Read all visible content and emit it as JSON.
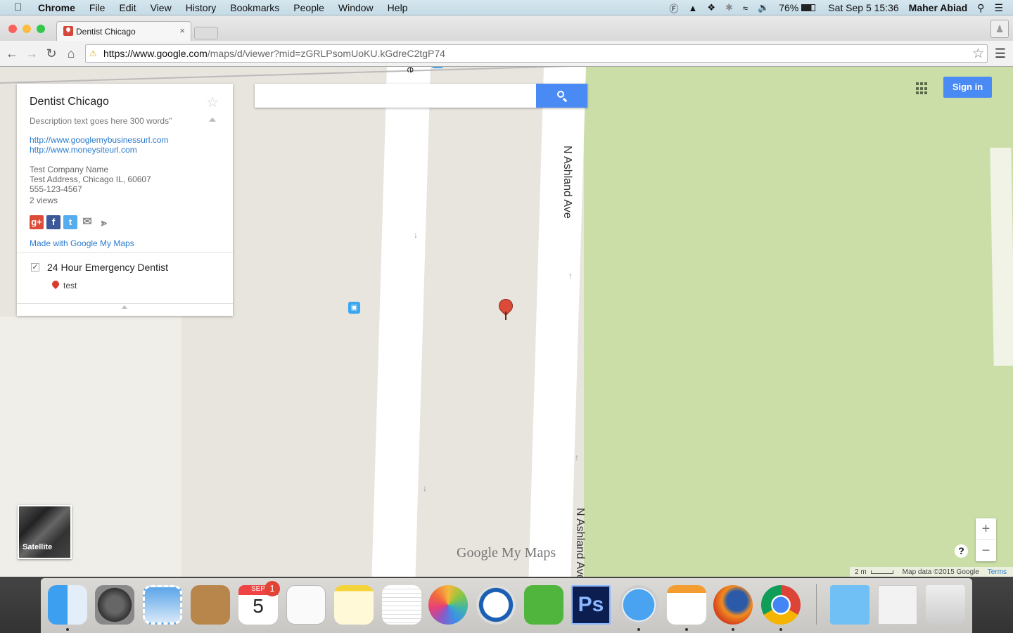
{
  "menubar": {
    "app_name": "Chrome",
    "items": [
      "File",
      "Edit",
      "View",
      "History",
      "Bookmarks",
      "People",
      "Window",
      "Help"
    ],
    "status": {
      "icons": [
        "typeeto-icon",
        "adobe-icon",
        "dropbox-icon",
        "bluetooth-icon",
        "wifi-icon",
        "volume-icon"
      ],
      "battery": "76%",
      "datetime": "Sat Sep 5  15:36",
      "user": "Maher Abiad"
    }
  },
  "browser": {
    "tab_title": "Dentist Chicago",
    "tab_close": "×",
    "url_host": "https://www.google.com",
    "url_path": "/maps/d/viewer?mid=zGRLPsomUoKU.kGdreC2tgP74"
  },
  "map_panel": {
    "title": "Dentist Chicago",
    "description": "Description text goes here 300 words\"",
    "links": [
      "http://www.googlemybusinessurl.com",
      "http://www.moneysiteurl.com"
    ],
    "company": "Test Company Name",
    "address": "Test Address, Chicago IL, 60607",
    "phone": "555-123-4567",
    "views": "2 views",
    "social": [
      {
        "name": "google-plus",
        "label": "g+",
        "color": "#dd4b39"
      },
      {
        "name": "facebook",
        "label": "f",
        "color": "#3b5998"
      },
      {
        "name": "twitter",
        "label": "t",
        "color": "#55acee"
      }
    ],
    "made_with": "Made with Google My Maps",
    "layer": {
      "name": "24 Hour Emergency Dentist",
      "checked": true,
      "features": [
        {
          "name": "test"
        }
      ]
    }
  },
  "search": {
    "value": "",
    "placeholder": ""
  },
  "map": {
    "street_labels": [
      "N Ashland Ave",
      "N Ashland Ave",
      "N Ashland Ave"
    ],
    "sign_in": "Sign in",
    "satellite_label": "Satellite",
    "watermark": "Google My Maps",
    "zoom_in": "+",
    "zoom_out": "−",
    "help": "?",
    "scale": "2 m",
    "copyright": "Map data ©2015 Google",
    "terms": "Terms",
    "colors": {
      "park": "#cbdea8",
      "land": "#e8e4de",
      "accent": "#4a8af4",
      "marker": "#dc4a38"
    }
  },
  "dock": {
    "apps": [
      "Finder",
      "System Preferences",
      "Mail",
      "Contacts",
      "Calendar",
      "Reminders",
      "Notes",
      "TextEdit",
      "Photos",
      "1Password",
      "Evernote",
      "Photoshop",
      "Safari",
      "Pages",
      "Firefox",
      "Chrome",
      "Documents",
      "TXT File",
      "Trash"
    ],
    "calendar_month": "SEP",
    "calendar_day": "5",
    "calendar_badge": "1"
  }
}
